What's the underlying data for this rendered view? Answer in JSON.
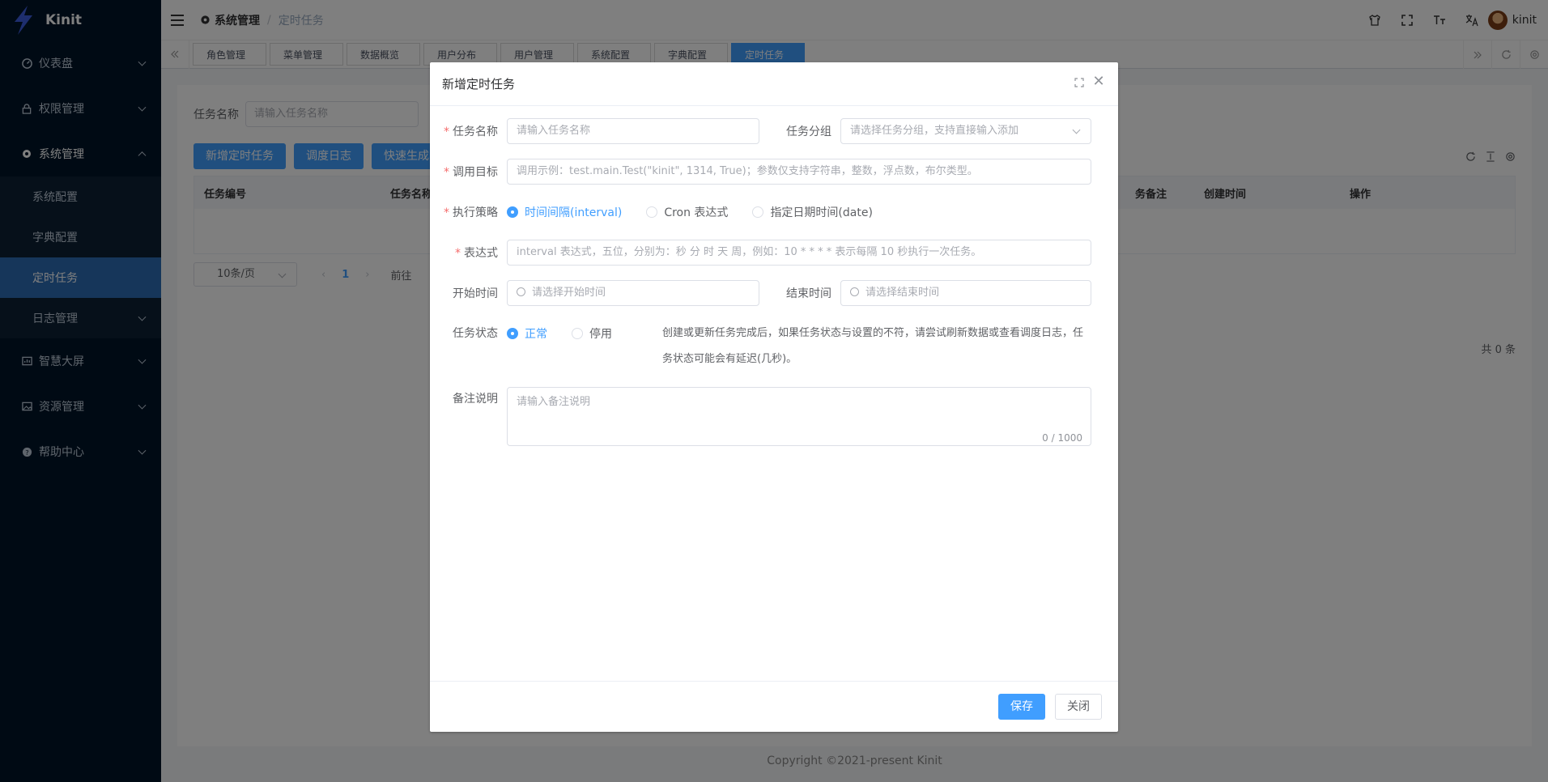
{
  "app": {
    "name": "Kinit"
  },
  "sidebar": {
    "items": [
      {
        "label": "仪表盘",
        "icon": "dashboard-icon"
      },
      {
        "label": "权限管理",
        "icon": "lock-icon"
      },
      {
        "label": "系统管理",
        "icon": "gear-icon"
      },
      {
        "label": "智慧大屏",
        "icon": "screen-icon"
      },
      {
        "label": "资源管理",
        "icon": "image-icon"
      },
      {
        "label": "帮助中心",
        "icon": "help-icon"
      }
    ],
    "sub_items": [
      {
        "label": "系统配置"
      },
      {
        "label": "字典配置"
      },
      {
        "label": "定时任务"
      },
      {
        "label": "日志管理"
      }
    ]
  },
  "header": {
    "breadcrumb_root": "系统管理",
    "breadcrumb_current": "定时任务",
    "username": "kinit"
  },
  "tabs": [
    "角色管理",
    "菜单管理",
    "数据概览",
    "用户分布",
    "用户管理",
    "系统配置",
    "字典配置",
    "定时任务"
  ],
  "page": {
    "search_label": "任务名称",
    "search_placeholder": "请输入任务名称",
    "buttons": [
      "新增定时任务",
      "调度日志",
      "快速生成 C"
    ],
    "columns": [
      "任务编号",
      "任务名称",
      "务备注",
      "创建时间",
      "操作"
    ],
    "page_size": "10条/页",
    "current_page": "1",
    "goto_label": "前往",
    "total": "共 0 条"
  },
  "footer": {
    "copyright": "Copyright ©2021-present Kinit"
  },
  "dialog": {
    "title": "新增定时任务",
    "fields": {
      "name_label": "任务名称",
      "name_placeholder": "请输入任务名称",
      "group_label": "任务分组",
      "group_placeholder": "请选择任务分组，支持直接输入添加",
      "target_label": "调用目标",
      "target_placeholder": "调用示例：test.main.Test(\"kinit\", 1314, True)；参数仅支持字符串，整数，浮点数，布尔类型。",
      "strategy_label": "执行策略",
      "strategy_options": [
        "时间间隔(interval)",
        "Cron 表达式",
        "指定日期时间(date)"
      ],
      "expr_label": "表达式",
      "expr_placeholder": "interval 表达式，五位，分别为：秒 分 时 天 周，例如：10 * * * * 表示每隔 10 秒执行一次任务。",
      "start_label": "开始时间",
      "start_placeholder": "请选择开始时间",
      "end_label": "结束时间",
      "end_placeholder": "请选择结束时间",
      "status_label": "任务状态",
      "status_options": [
        "正常",
        "停用"
      ],
      "status_hint": "创建或更新任务完成后，如果任务状态与设置的不符，请尝试刷新数据或查看调度日志，任务状态可能会有延迟(几秒)。",
      "remark_label": "备注说明",
      "remark_placeholder": "请输入备注说明",
      "remark_counter": "0 / 1000"
    },
    "save": "保存",
    "close": "关闭"
  },
  "colors": {
    "primary": "#409eff",
    "sidebar": "#001529",
    "active_menu": "#2d6cb5",
    "required": "#f56c6c"
  }
}
